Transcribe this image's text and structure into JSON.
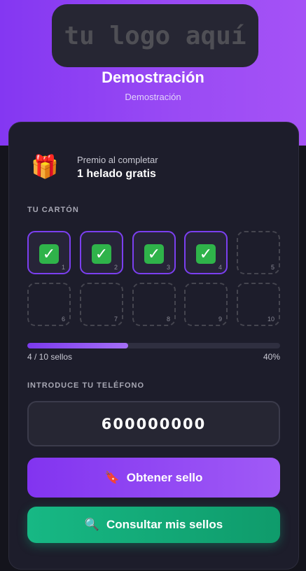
{
  "brand": {
    "logo_text": "tu logo aquí",
    "name": "Demostración",
    "subtitle": "Demostración"
  },
  "prize": {
    "icon": "gift-icon",
    "label": "Premio al completar",
    "value": "1 helado gratis"
  },
  "card": {
    "section_label": "TU CARTÓN",
    "stamps": [
      {
        "number": "1",
        "filled": true
      },
      {
        "number": "2",
        "filled": true
      },
      {
        "number": "3",
        "filled": true
      },
      {
        "number": "4",
        "filled": true
      },
      {
        "number": "5",
        "filled": false
      },
      {
        "number": "6",
        "filled": false
      },
      {
        "number": "7",
        "filled": false
      },
      {
        "number": "8",
        "filled": false
      },
      {
        "number": "9",
        "filled": false
      },
      {
        "number": "10",
        "filled": false
      }
    ],
    "stamp_icon": "check-mark-icon",
    "stamp_glyph": "✓"
  },
  "progress": {
    "count_text": "4 / 10 sellos",
    "percent_text": "40%",
    "fraction": 0.4
  },
  "phone": {
    "label": "INTRODUCE TU TELÉFONO",
    "value": "600000000"
  },
  "actions": {
    "get_stamp_label": "Obtener sello",
    "get_stamp_icon": "bookmark-icon",
    "check_stamps_label": "Consultar mis sellos",
    "check_stamps_icon": "magnifier-icon"
  },
  "colors": {
    "accent_purple": "#8234f0",
    "accent_green": "#17b884",
    "card_bg": "#1d1d2b",
    "page_bg": "#14141c"
  }
}
